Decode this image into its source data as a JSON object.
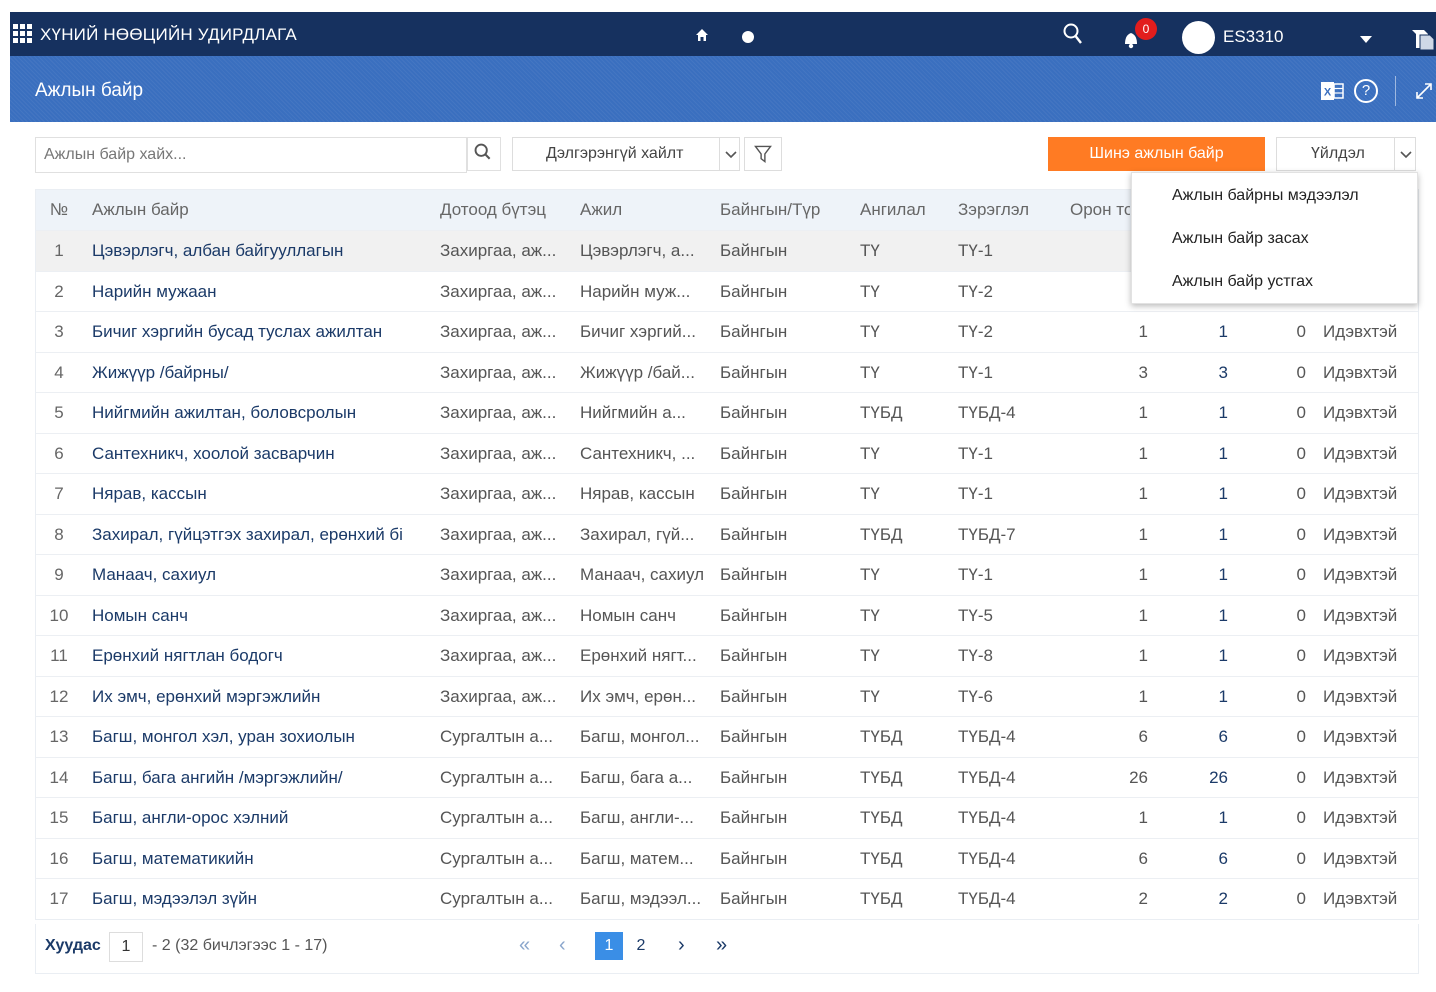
{
  "topbar": {
    "app_title": "ХҮНИЙ НӨӨЦИЙН УДИРДЛАГА",
    "notification_count": "0",
    "user_name": "ES3310"
  },
  "titlebar": {
    "page_title": "Ажлын байр",
    "help_glyph": "?"
  },
  "toolbar": {
    "search_placeholder": "Ажлын байр хайх...",
    "advanced_search_label": "Дэлгэрэнгүй хайлт",
    "new_button_label": "Шинэ ажлын байр",
    "action_button_label": "Үйлдэл"
  },
  "action_menu": {
    "items": [
      "Ажлын байрны мэдээлэл",
      "Ажлын байр засах",
      "Ажлын байр устгах"
    ]
  },
  "table": {
    "headers": {
      "no": "№",
      "name": "Ажлын байр",
      "unit": "Дотоод бүтэц",
      "job": "Ажил",
      "type": "Байнгын/Түр",
      "category": "Ангилал",
      "grade": "Зэрэглэл",
      "positions": "Орон тоо"
    },
    "rows": [
      {
        "no": "1",
        "name": "Цэвэрлэгч, албан байгууллагын",
        "unit": "Захиргаа, аж...",
        "job": "Цэвэрлэгч, а...",
        "type": "Байнгын",
        "category": "ТҮ",
        "grade": "ТҮ-1",
        "positions": "",
        "active": "",
        "vacant": "",
        "status": ""
      },
      {
        "no": "2",
        "name": "Нарийн мужаан",
        "unit": "Захиргаа, аж...",
        "job": "Нарийн муж...",
        "type": "Байнгын",
        "category": "ТҮ",
        "grade": "ТҮ-2",
        "positions": "",
        "active": "",
        "vacant": "",
        "status": ""
      },
      {
        "no": "3",
        "name": "Бичиг хэргийн бусад туслах ажилтан",
        "unit": "Захиргаа, аж...",
        "job": "Бичиг хэргий...",
        "type": "Байнгын",
        "category": "ТҮ",
        "grade": "ТҮ-2",
        "positions": "1",
        "active": "1",
        "vacant": "0",
        "status": "Идэвхтэй"
      },
      {
        "no": "4",
        "name": "Жижүүр /байрны/",
        "unit": "Захиргаа, аж...",
        "job": "Жижүүр /бай...",
        "type": "Байнгын",
        "category": "ТҮ",
        "grade": "ТҮ-1",
        "positions": "3",
        "active": "3",
        "vacant": "0",
        "status": "Идэвхтэй"
      },
      {
        "no": "5",
        "name": "Нийгмийн ажилтан, боловсролын",
        "unit": "Захиргаа, аж...",
        "job": "Нийгмийн а...",
        "type": "Байнгын",
        "category": "ТҮБД",
        "grade": "ТҮБД-4",
        "positions": "1",
        "active": "1",
        "vacant": "0",
        "status": "Идэвхтэй"
      },
      {
        "no": "6",
        "name": "Сантехникч, хоолой засварчин",
        "unit": "Захиргаа, аж...",
        "job": "Сантехникч, ...",
        "type": "Байнгын",
        "category": "ТҮ",
        "grade": "ТҮ-1",
        "positions": "1",
        "active": "1",
        "vacant": "0",
        "status": "Идэвхтэй"
      },
      {
        "no": "7",
        "name": "Нярав, кассын",
        "unit": "Захиргаа, аж...",
        "job": "Нярав, кассын",
        "type": "Байнгын",
        "category": "ТҮ",
        "grade": "ТҮ-1",
        "positions": "1",
        "active": "1",
        "vacant": "0",
        "status": "Идэвхтэй"
      },
      {
        "no": "8",
        "name": "Захирал, гүйцэтгэх захирал, ерөнхий бі",
        "unit": "Захиргаа, аж...",
        "job": "Захирал, гүй...",
        "type": "Байнгын",
        "category": "ТҮБД",
        "grade": "ТҮБД-7",
        "positions": "1",
        "active": "1",
        "vacant": "0",
        "status": "Идэвхтэй"
      },
      {
        "no": "9",
        "name": "Манаач, сахиул",
        "unit": "Захиргаа, аж...",
        "job": "Манаач, сахиул",
        "type": "Байнгын",
        "category": "ТҮ",
        "grade": "ТҮ-1",
        "positions": "1",
        "active": "1",
        "vacant": "0",
        "status": "Идэвхтэй"
      },
      {
        "no": "10",
        "name": "Номын санч",
        "unit": "Захиргаа, аж...",
        "job": "Номын санч",
        "type": "Байнгын",
        "category": "ТҮ",
        "grade": "ТҮ-5",
        "positions": "1",
        "active": "1",
        "vacant": "0",
        "status": "Идэвхтэй"
      },
      {
        "no": "11",
        "name": "Ерөнхий нягтлан бодогч",
        "unit": "Захиргаа, аж...",
        "job": "Ерөнхий нягт...",
        "type": "Байнгын",
        "category": "ТҮ",
        "grade": "ТҮ-8",
        "positions": "1",
        "active": "1",
        "vacant": "0",
        "status": "Идэвхтэй"
      },
      {
        "no": "12",
        "name": "Их эмч, ерөнхий мэргэжлийн",
        "unit": "Захиргаа, аж...",
        "job": "Их эмч, ерөн...",
        "type": "Байнгын",
        "category": "ТҮ",
        "grade": "ТҮ-6",
        "positions": "1",
        "active": "1",
        "vacant": "0",
        "status": "Идэвхтэй"
      },
      {
        "no": "13",
        "name": "Багш, монгол хэл, уран зохиолын",
        "unit": "Сургалтын а...",
        "job": "Багш, монгол...",
        "type": "Байнгын",
        "category": "ТҮБД",
        "grade": "ТҮБД-4",
        "positions": "6",
        "active": "6",
        "vacant": "0",
        "status": "Идэвхтэй"
      },
      {
        "no": "14",
        "name": "Багш, бага ангийн /мэргэжлийн/",
        "unit": "Сургалтын а...",
        "job": "Багш, бага а...",
        "type": "Байнгын",
        "category": "ТҮБД",
        "grade": "ТҮБД-4",
        "positions": "26",
        "active": "26",
        "vacant": "0",
        "status": "Идэвхтэй"
      },
      {
        "no": "15",
        "name": "Багш, англи-орос хэлний",
        "unit": "Сургалтын а...",
        "job": "Багш, англи-...",
        "type": "Байнгын",
        "category": "ТҮБД",
        "grade": "ТҮБД-4",
        "positions": "1",
        "active": "1",
        "vacant": "0",
        "status": "Идэвхтэй"
      },
      {
        "no": "16",
        "name": "Багш, математикийн",
        "unit": "Сургалтын а...",
        "job": "Багш, матем...",
        "type": "Байнгын",
        "category": "ТҮБД",
        "grade": "ТҮБД-4",
        "positions": "6",
        "active": "6",
        "vacant": "0",
        "status": "Идэвхтэй"
      },
      {
        "no": "17",
        "name": "Багш, мэдээлэл зүйн",
        "unit": "Сургалтын а...",
        "job": "Багш, мэдээл...",
        "type": "Байнгын",
        "category": "ТҮБД",
        "grade": "ТҮБД-4",
        "positions": "2",
        "active": "2",
        "vacant": "0",
        "status": "Идэвхтэй"
      }
    ]
  },
  "pager": {
    "label": "Хуудас",
    "current_page": "1",
    "info": "- 2 (32 бичлэгээс 1 - 17)",
    "first": "«",
    "prev": "‹",
    "pages": [
      "1",
      "2"
    ],
    "next": "›",
    "last": "»"
  },
  "colors": {
    "topbar": "#16315f",
    "titlebar": "#3a6fbf",
    "primary_button": "#ff7b23",
    "active_page": "#3a8ee6",
    "notification_badge": "#e21d1d"
  },
  "icons": [
    "apps-grid-icon",
    "home-icon",
    "dot-icon",
    "search-icon",
    "bell-icon",
    "avatar",
    "chevron-down-icon",
    "layers-icon",
    "excel-icon",
    "help-icon",
    "expand-icon",
    "filter-icon"
  ]
}
